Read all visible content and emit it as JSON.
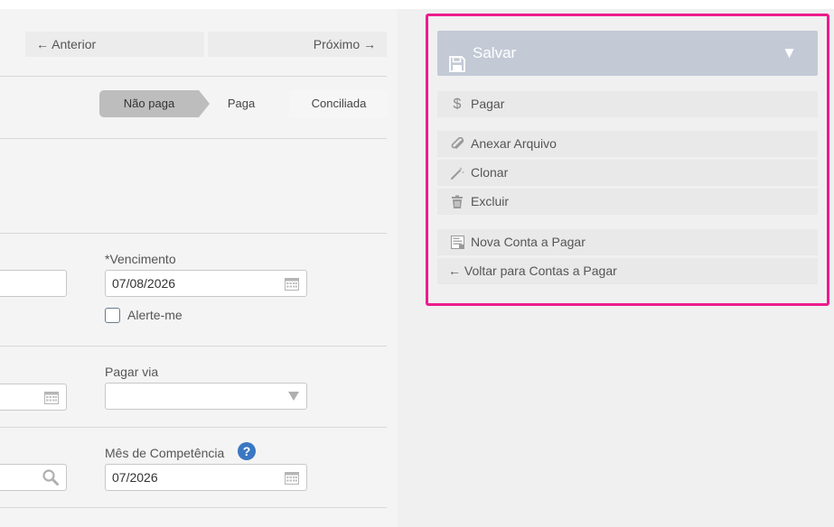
{
  "nav": {
    "prev_label": "← Anterior",
    "next_label": "Próximo →"
  },
  "status": {
    "steps": [
      "Não paga",
      "Paga",
      "Conciliada"
    ],
    "active": "Não paga"
  },
  "form": {
    "vencimento_label": "*Vencimento",
    "vencimento_value": "07/08/2026",
    "alert_label": "Alerte-me",
    "pagar_via_label": "Pagar via",
    "pagar_via_value": "",
    "competencia_label": "Mês de Competência",
    "competencia_value": "07/2026",
    "help_glyph": "?"
  },
  "actions": {
    "save_label": "Salvar",
    "caret": "▼",
    "pagar_icon": "$",
    "items": [
      {
        "label": "Pagar",
        "icon": "dollar-icon"
      },
      {
        "label": "Anexar Arquivo",
        "icon": "paperclip-icon"
      },
      {
        "label": "Clonar",
        "icon": "magic-wand-icon"
      },
      {
        "label": "Excluir",
        "icon": "trash-icon"
      },
      {
        "label": "Nova Conta a Pagar",
        "icon": "document-icon"
      },
      {
        "label": "← Voltar para Contas a Pagar",
        "icon": ""
      }
    ]
  },
  "colors": {
    "highlight": "#ec1c8c",
    "save_bg": "#c3cad6",
    "help": "#3b78c2"
  }
}
